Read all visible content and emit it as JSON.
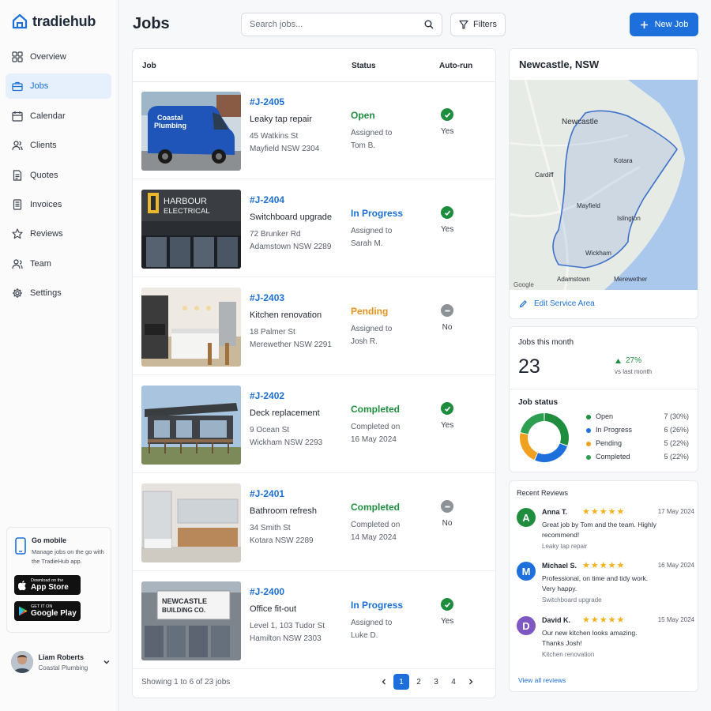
{
  "app": {
    "logo_text": "tradiehub"
  },
  "sidebar": {
    "items": [
      {
        "label": "Overview",
        "icon": "grid-icon"
      },
      {
        "label": "Jobs",
        "icon": "briefcase-icon",
        "active": true
      },
      {
        "label": "Calendar",
        "icon": "calendar-icon"
      },
      {
        "label": "Clients",
        "icon": "users-icon"
      },
      {
        "label": "Quotes",
        "icon": "document-icon"
      },
      {
        "label": "Invoices",
        "icon": "invoice-icon"
      },
      {
        "label": "Reviews",
        "icon": "star-icon"
      },
      {
        "label": "Team",
        "icon": "team-icon"
      },
      {
        "label": "Settings",
        "icon": "gear-icon"
      }
    ],
    "promo": {
      "title": "Go mobile",
      "text": "Manage jobs on the go with the TradieHub app.",
      "appstore_small": "Download on the",
      "appstore_big": "App Store",
      "play_small": "GET IT ON",
      "play_big": "Google Play"
    },
    "user": {
      "name": "Liam Roberts",
      "company": "Coastal Plumbing"
    }
  },
  "header": {
    "title": "Jobs",
    "search_placeholder": "Search jobs...",
    "filters_label": "Filters",
    "new_job_label": "New Job"
  },
  "table": {
    "columns": {
      "job": "Job",
      "status": "Status",
      "autorun": "Auto-run"
    },
    "rows": [
      {
        "id": "#J-2405",
        "title": "Leaky tap repair",
        "addr1": "45 Watkins St",
        "addr2": "Mayfield NSW 2304",
        "status": "Open",
        "status_color": "#1e8e3e",
        "assign1": "Assigned to",
        "assign2": "Tom B.",
        "auto": "Yes",
        "thumb": "van"
      },
      {
        "id": "#J-2404",
        "title": "Switchboard upgrade",
        "addr1": "72 Brunker Rd",
        "addr2": "Adamstown NSW 2289",
        "status": "In Progress",
        "status_color": "#1b6fd8",
        "assign1": "Assigned to",
        "assign2": "Sarah M.",
        "auto": "Yes",
        "thumb": "shopfront"
      },
      {
        "id": "#J-2403",
        "title": "Kitchen renovation",
        "addr1": "18 Palmer St",
        "addr2": "Merewether NSW 2291",
        "status": "Pending",
        "status_color": "#e8921c",
        "assign1": "Assigned to",
        "assign2": "Josh R.",
        "auto": "No",
        "thumb": "kitchen"
      },
      {
        "id": "#J-2402",
        "title": "Deck replacement",
        "addr1": "9 Ocean St",
        "addr2": "Wickham NSW 2293",
        "status": "Completed",
        "status_color": "#1e8e3e",
        "assign1": "Completed on",
        "assign2": "16 May 2024",
        "auto": "Yes",
        "thumb": "house"
      },
      {
        "id": "#J-2401",
        "title": "Bathroom refresh",
        "addr1": "34 Smith St",
        "addr2": "Kotara NSW 2289",
        "status": "Completed",
        "status_color": "#1e8e3e",
        "assign1": "Completed on",
        "assign2": "14 May 2024",
        "auto": "No",
        "thumb": "bathroom"
      },
      {
        "id": "#J-2400",
        "title": "Office fit-out",
        "addr1": "Level 1, 103 Tudor St",
        "addr2": "Hamilton NSW 2303",
        "status": "In Progress",
        "status_color": "#1b6fd8",
        "assign1": "Assigned to",
        "assign2": "Luke D.",
        "auto": "Yes",
        "thumb": "building"
      }
    ],
    "thumb_text": {
      "van1": "Coastal",
      "van2": "Plumbing",
      "shop1": "HARBOUR",
      "shop2": "ELECTRICAL",
      "bldg1": "NEWCASTLE",
      "bldg2": "BUILDING CO."
    },
    "showing": "Showing 1 to 6 of 23 jobs",
    "pages": [
      "1",
      "2",
      "3",
      "4"
    ],
    "current_page": "1"
  },
  "map_card": {
    "title": "Newcastle, NSW",
    "places": [
      "Newcastle",
      "Kotara",
      "Cardiff",
      "Mayfield",
      "Islington",
      "Wickham",
      "Adamstown",
      "Merewether"
    ],
    "google": "Google",
    "edit_label": "Edit Service Area"
  },
  "stats": {
    "label": "Jobs this month",
    "value": "23",
    "trend": "27%",
    "trend_sub": "vs last month",
    "status_title": "Job status",
    "status": [
      {
        "label": "Open",
        "value": "7 (30%)",
        "count": 7,
        "color": "#1e8e3e"
      },
      {
        "label": "In Progress",
        "value": "6 (26%)",
        "count": 6,
        "color": "#1d6fdb"
      },
      {
        "label": "Pending",
        "value": "5 (22%)",
        "count": 5,
        "color": "#f0a020"
      },
      {
        "label": "Completed",
        "value": "5 (22%)",
        "count": 5,
        "color": "#2e9e50"
      }
    ]
  },
  "reviews": {
    "title": "Recent Reviews",
    "stars": "★★★★★",
    "items": [
      {
        "initial": "A",
        "name": "Anna T.",
        "date": "17 May 2024",
        "text": "Great job by Tom and the team. Highly recommend!",
        "job": "Leaky tap repair",
        "color": "#1e8e3e"
      },
      {
        "initial": "M",
        "name": "Michael S.",
        "date": "16 May 2024",
        "text": "Professional, on time and tidy work. Very happy.",
        "job": "Switchboard upgrade",
        "color": "#1d6fdb"
      },
      {
        "initial": "D",
        "name": "David K.",
        "date": "15 May 2024",
        "text": "Our new kitchen looks amazing. Thanks Josh!",
        "job": "Kitchen renovation",
        "color": "#7e57c2"
      }
    ],
    "view_all": "View all reviews"
  }
}
